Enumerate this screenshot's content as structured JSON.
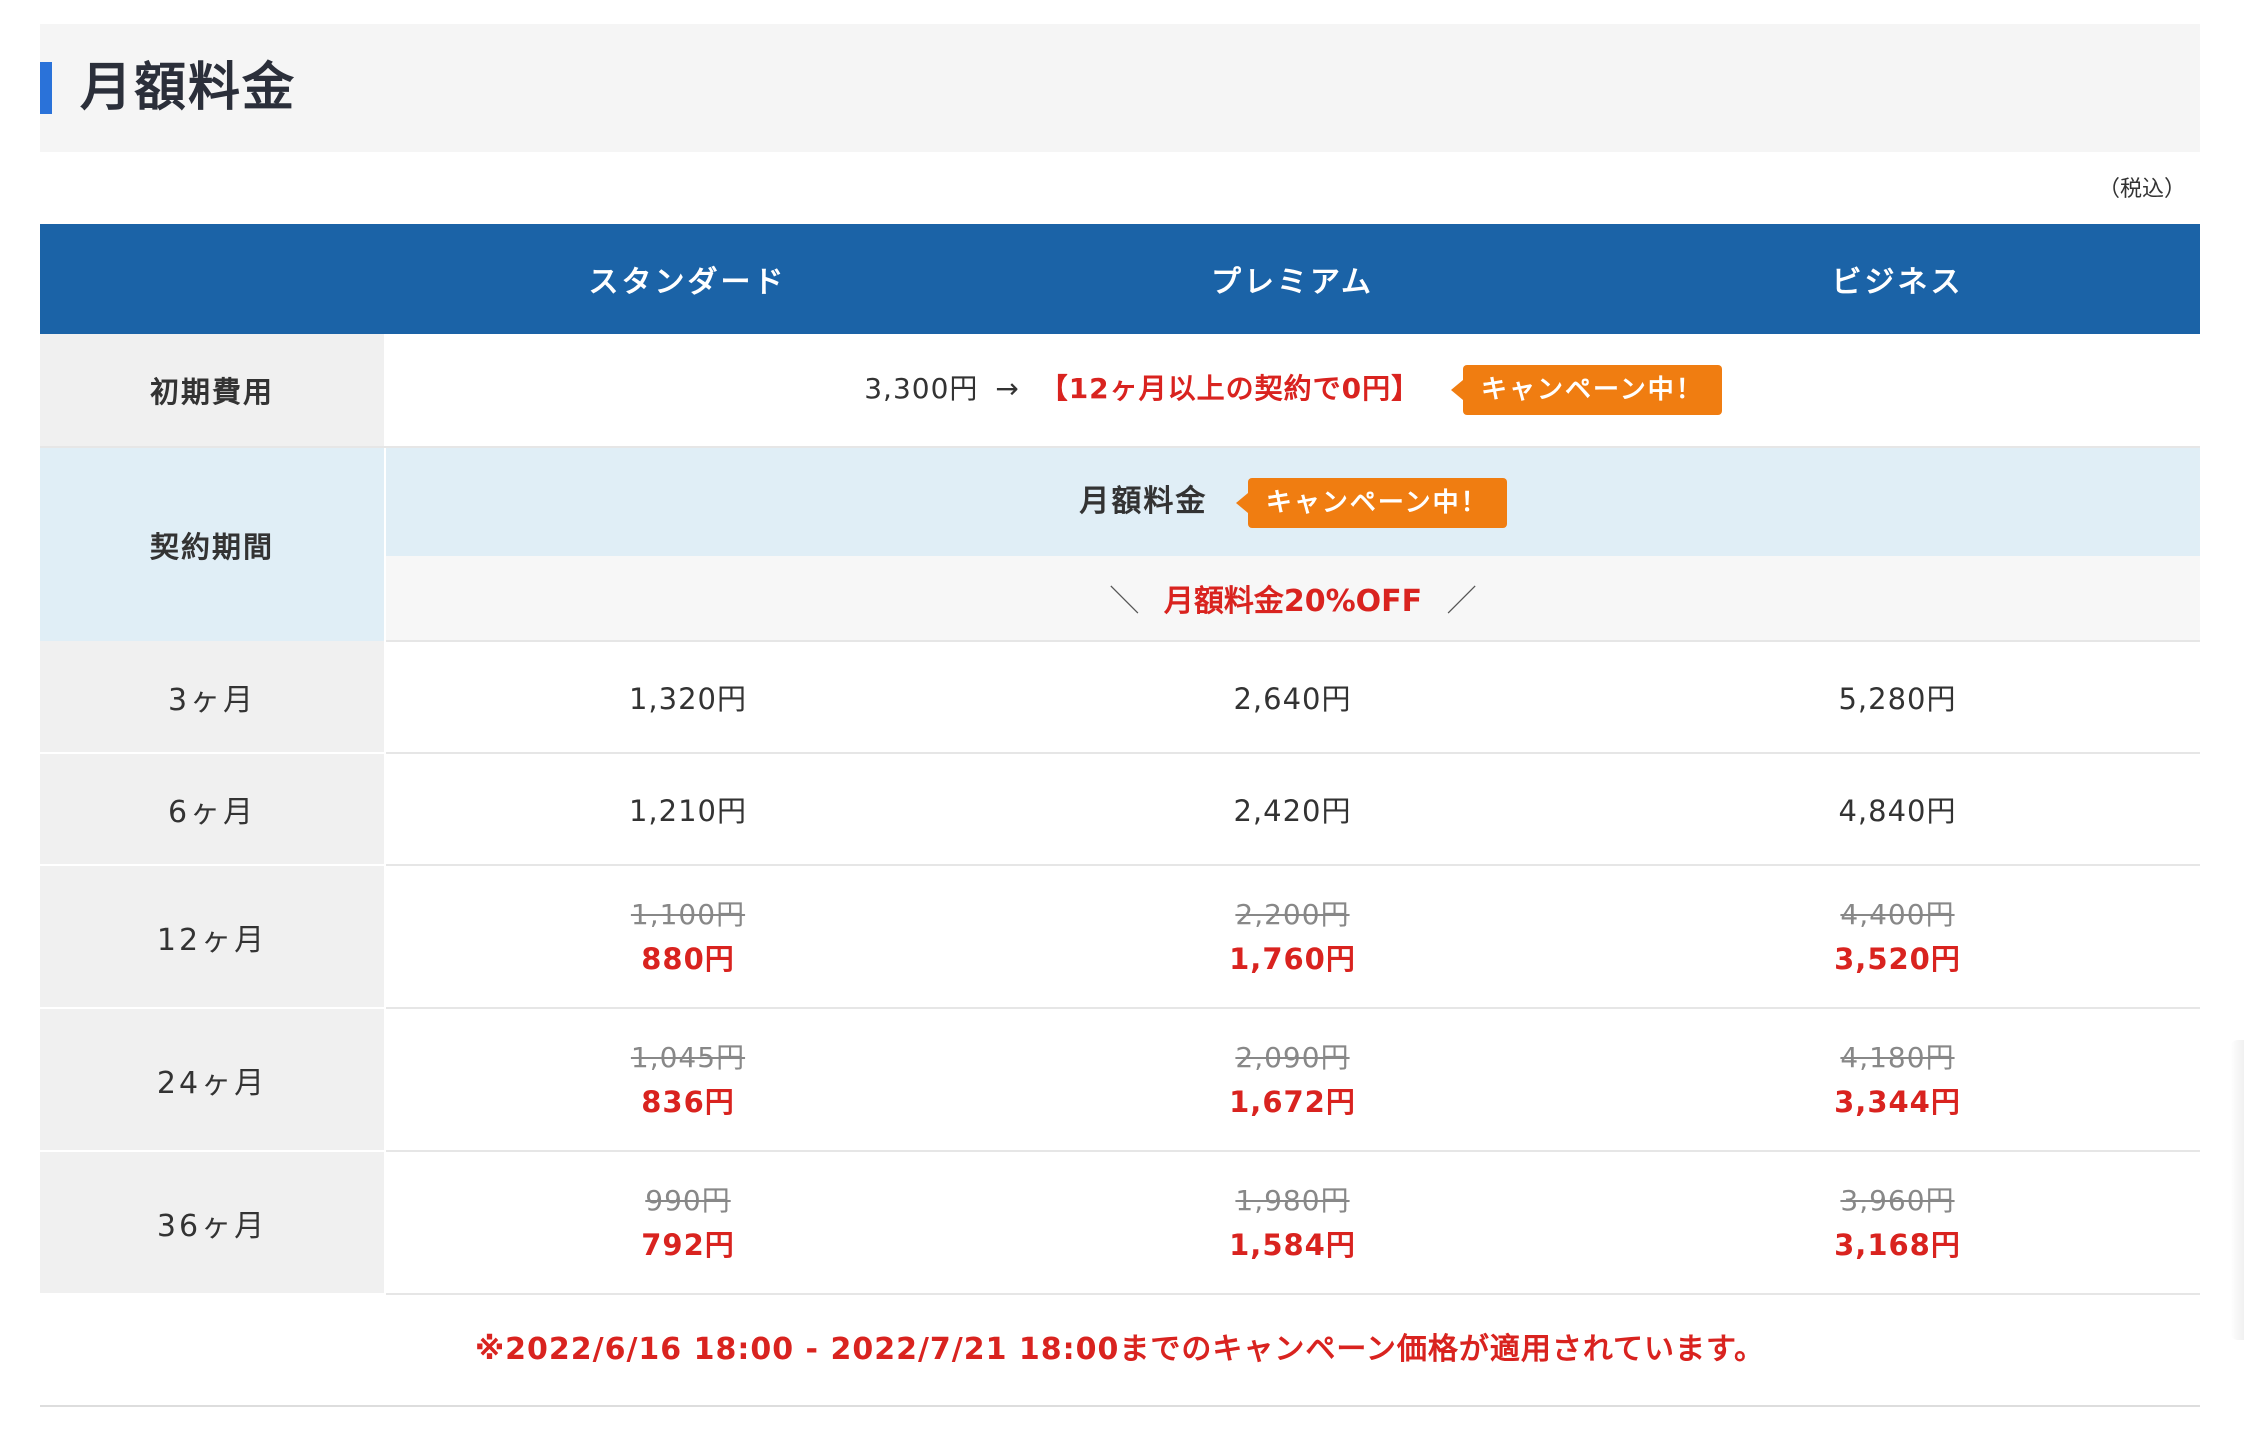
{
  "section": {
    "title": "月額料金",
    "tax_note": "（税込）"
  },
  "table": {
    "headers": [
      "",
      "スタンダード",
      "プレミアム",
      "ビジネス"
    ],
    "initial_fee": {
      "label": "初期費用",
      "price": "3,300円",
      "arrow": "→",
      "promo": "【12ヶ月以上の契約で0円】",
      "badge": "キャンペーン中！"
    },
    "contract": {
      "label": "契約期間",
      "monthly_label": "月額料金",
      "badge": "キャンペーン中！",
      "discount_left": "＼",
      "discount_text": "月額料金20%OFF",
      "discount_right": "／"
    },
    "rows": [
      {
        "period": "3ヶ月",
        "prices": [
          {
            "price": "1,320円"
          },
          {
            "price": "2,640円"
          },
          {
            "price": "5,280円"
          }
        ]
      },
      {
        "period": "6ヶ月",
        "prices": [
          {
            "price": "1,210円"
          },
          {
            "price": "2,420円"
          },
          {
            "price": "4,840円"
          }
        ]
      },
      {
        "period": "12ヶ月",
        "prices": [
          {
            "old": "1,100円",
            "new": "880円"
          },
          {
            "old": "2,200円",
            "new": "1,760円"
          },
          {
            "old": "4,400円",
            "new": "3,520円"
          }
        ]
      },
      {
        "period": "24ヶ月",
        "prices": [
          {
            "old": "1,045円",
            "new": "836円"
          },
          {
            "old": "2,090円",
            "new": "1,672円"
          },
          {
            "old": "4,180円",
            "new": "3,344円"
          }
        ]
      },
      {
        "period": "36ヶ月",
        "prices": [
          {
            "old": "990円",
            "new": "792円"
          },
          {
            "old": "1,980円",
            "new": "1,584円"
          },
          {
            "old": "3,960円",
            "new": "3,168円"
          }
        ]
      }
    ]
  },
  "campaign_note": "※2022/6/16 18:00 - 2022/7/21 18:00までのキャンペーン価格が適用されています。",
  "colors": {
    "header_blue": "#1b63a7",
    "accent_bar": "#2a72d9",
    "badge_orange": "#f07d11",
    "promo_red": "#d9231f",
    "light_blue_bg": "#e0eef6"
  }
}
